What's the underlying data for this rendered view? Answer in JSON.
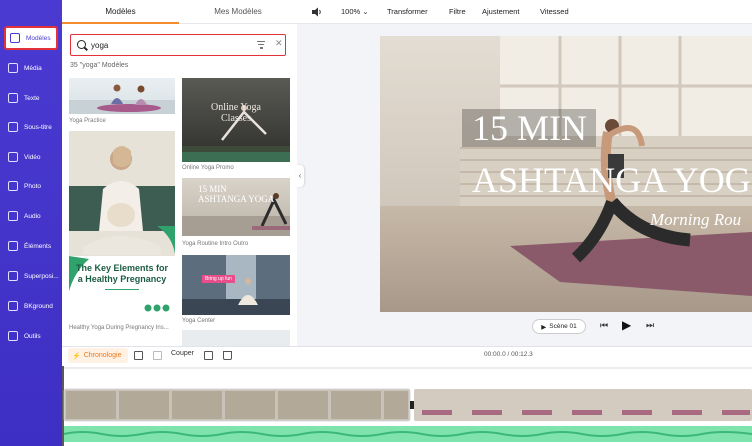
{
  "sidebar": {
    "items": [
      {
        "label": "Modèles",
        "icon": "layers-icon",
        "active": true
      },
      {
        "label": "Média",
        "icon": "folder-icon"
      },
      {
        "label": "Texte",
        "icon": "text-icon"
      },
      {
        "label": "Sous-titre",
        "icon": "subtitle-icon"
      },
      {
        "label": "Vidéo",
        "icon": "video-icon"
      },
      {
        "label": "Photo",
        "icon": "photo-icon"
      },
      {
        "label": "Audio",
        "icon": "audio-icon"
      },
      {
        "label": "Éléments",
        "icon": "elements-icon"
      },
      {
        "label": "Superposi...",
        "icon": "overlay-icon"
      },
      {
        "label": "BKground",
        "icon": "background-icon"
      },
      {
        "label": "Outils",
        "icon": "tools-icon"
      }
    ]
  },
  "panel": {
    "tabs": [
      "Modèles",
      "Mes Modèles"
    ],
    "search_value": "yoga",
    "result_count": "35 \"yoga\" Modèles",
    "templates": [
      {
        "label": "Yoga Practice"
      },
      {
        "label": "Online Yoga Promo",
        "title_line1": "Online Yoga",
        "title_line2": "Classes"
      },
      {
        "label": "Yoga Routine Intro Outro",
        "title_line1": "15 MIN",
        "title_line2": "ASHTANGA YOGA"
      },
      {
        "label": "Healthy Yoga During Pregnancy Ins...",
        "headline_line1": "The Key Elements for",
        "headline_line2": "a Healthy Pregnancy"
      },
      {
        "label": "Yoga Center",
        "badge": "Bring up fun"
      }
    ]
  },
  "toolbar": {
    "volume_icon": "speaker-icon",
    "zoom": "100%",
    "buttons": [
      "Transformer",
      "Filtre",
      "Ajustement",
      "Vitessed"
    ]
  },
  "preview": {
    "title_line1": "15 MIN",
    "title_line2": "ASHTANGA YOG",
    "subtitle": "Morning Rou"
  },
  "playback": {
    "scene_label": "Scène 01"
  },
  "timeline": {
    "chronologie_label": "Chronologie",
    "cut_label": "Couper",
    "timecode": "00:00.0 / 00:12.3"
  },
  "colors": {
    "sidebar": "#4a3ad1",
    "accent_orange": "#f28c2e",
    "highlight_red": "#e3313a",
    "audio_green": "#62d79b"
  }
}
